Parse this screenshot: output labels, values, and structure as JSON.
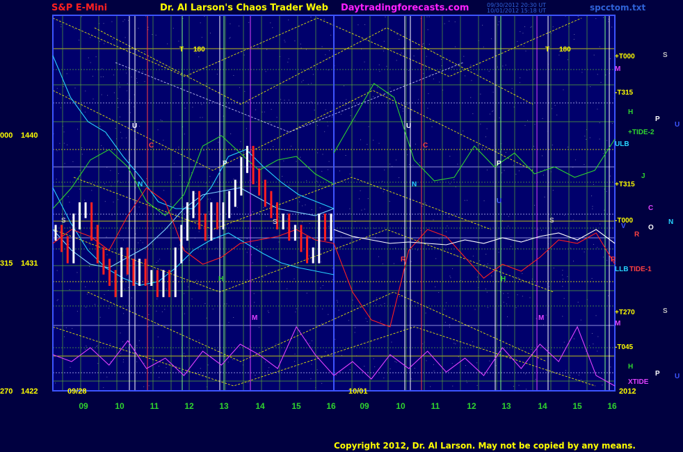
{
  "header": {
    "symbol": "S&P E-Mini",
    "title": "Dr. Al Larson's Chaos Trader Web",
    "site": "Daytradingforecasts.com",
    "stamp1": "09/30/2012 20:30 UT",
    "stamp2": "10/01/2012 15:18 UT",
    "file": "spcctom.txt"
  },
  "copyright": "Copyright 2012, Dr. Al Larson. May not be copied by any means.",
  "colors": {
    "background": "#000040",
    "plot_bg": "#00006c",
    "grid": "#5aa83a",
    "frame": "#3d55ff",
    "yellow": "#ffff00",
    "red": "#ff2020",
    "cyan": "#27d4ff",
    "magenta": "#e040ff"
  },
  "chart_data": {
    "type": "line",
    "title": "S&P E-Mini",
    "price_labels": [
      {
        "left": "000",
        "price": "1440"
      },
      {
        "left": "315",
        "price": "1431"
      },
      {
        "left": "270",
        "price": "1422"
      }
    ],
    "day_labels": [
      "09/28",
      "10/01"
    ],
    "year_label": "2012",
    "x_ticks_panel1": [
      "09",
      "10",
      "11",
      "12",
      "13",
      "14",
      "15",
      "16"
    ],
    "x_ticks_panel2": [
      "09",
      "10",
      "11",
      "12",
      "13",
      "14",
      "15",
      "16"
    ],
    "flux_labels_right": [
      "+T000",
      "M",
      "-T315",
      "H",
      "+TIDE-2",
      "ULB",
      "+T315",
      "J",
      "-T000",
      "V",
      "LLB",
      "TIDE-1",
      "+T270",
      "M",
      "-T045",
      "H",
      "XTIDE"
    ],
    "far_right_labels": [
      "S",
      "P",
      "U",
      "C",
      "N",
      "O",
      "R",
      "R",
      "S",
      "P",
      "U"
    ],
    "panel_markers": [
      "T",
      "180",
      "T",
      "180",
      "U",
      "C",
      "N",
      "P",
      "S",
      "H",
      "M",
      "U",
      "C",
      "N",
      "P",
      "S",
      "H",
      "M",
      "U",
      "S",
      "R"
    ],
    "price_series_first_day": [
      1434,
      1433,
      1432,
      1435,
      1436,
      1436,
      1434,
      1432,
      1431,
      1430,
      1429,
      1432,
      1431,
      1430,
      1431,
      1430,
      1430,
      1429,
      1430,
      1429,
      1432,
      1434,
      1436,
      1437,
      1435,
      1434,
      1436,
      1435,
      1436,
      1437,
      1438,
      1440,
      1441,
      1439,
      1438,
      1437,
      1436,
      1435,
      1435,
      1434,
      1434,
      1433,
      1432,
      1432,
      1435,
      1434,
      1435
    ],
    "volume_note": "XTIDE oscillator shown in magenta at bottom"
  }
}
